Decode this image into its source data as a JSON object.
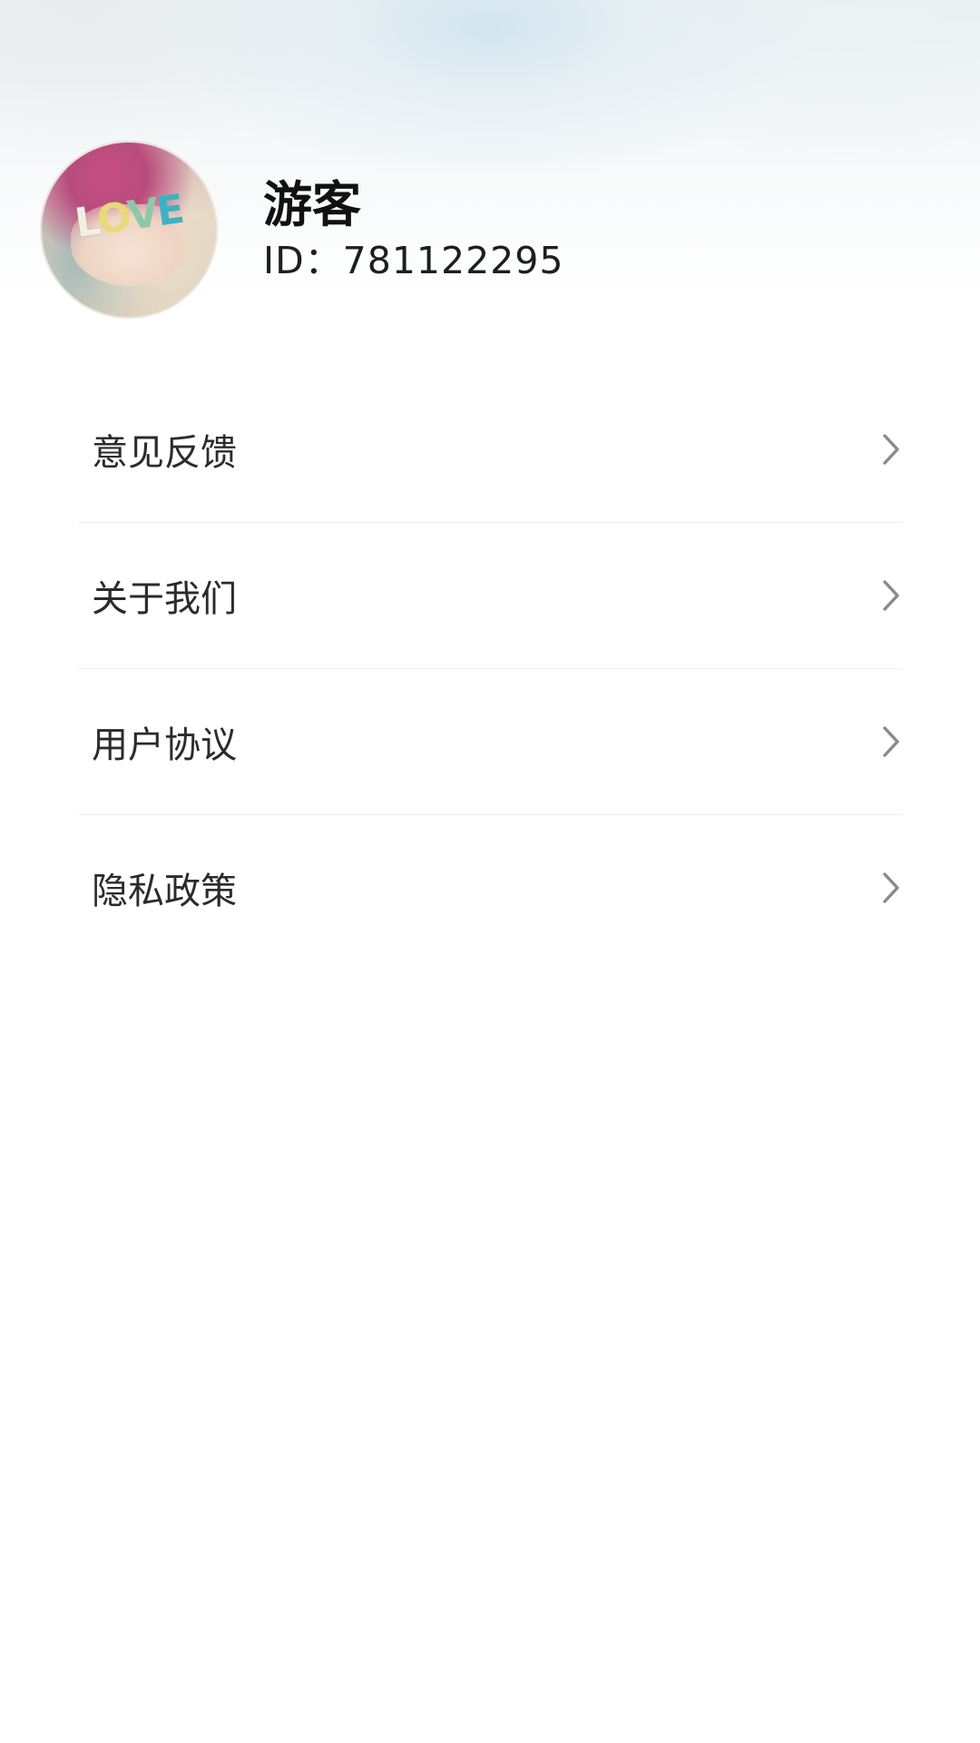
{
  "profile": {
    "nickname": "游客",
    "id_text": "ID：781122295",
    "avatar_text": "LOVE"
  },
  "menu": {
    "items": [
      {
        "label": "意见反馈",
        "icon": "chevron-right-icon"
      },
      {
        "label": "关于我们",
        "icon": "chevron-right-icon"
      },
      {
        "label": "用户协议",
        "icon": "chevron-right-icon"
      },
      {
        "label": "隐私政策",
        "icon": "chevron-right-icon"
      }
    ]
  },
  "colors": {
    "text_primary": "#111111",
    "menu_text": "#2b2b2b",
    "chevron": "#8a8a8a",
    "divider": "#eeeeee",
    "background": "#ffffff"
  }
}
